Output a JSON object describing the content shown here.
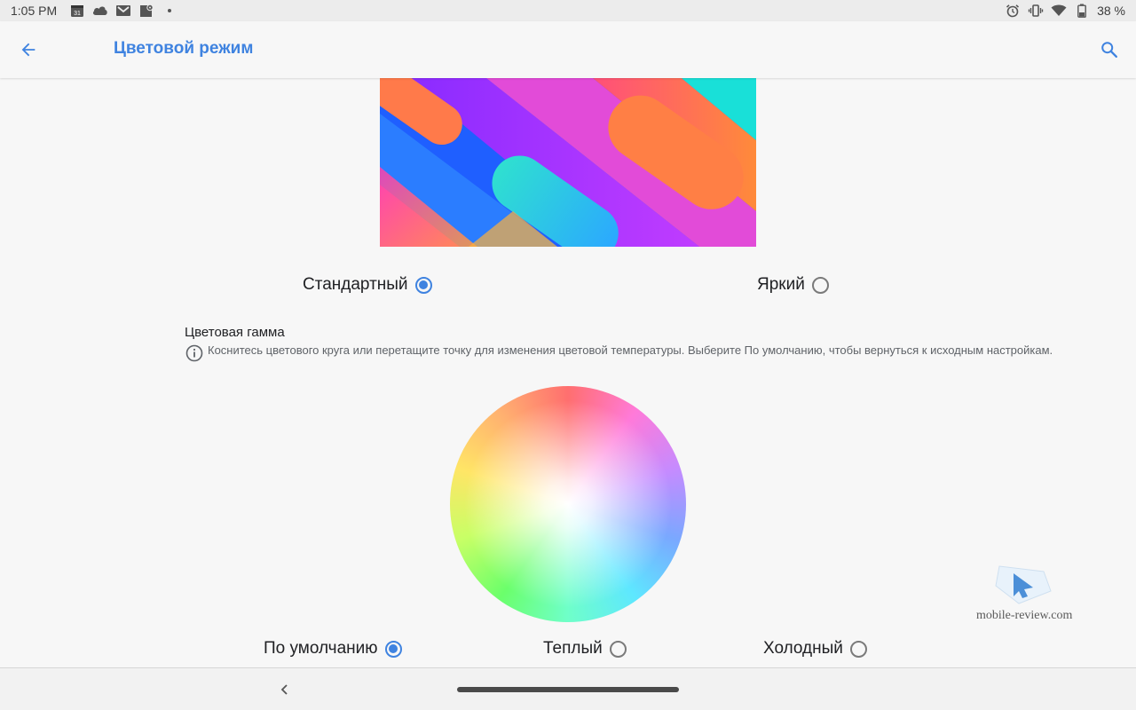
{
  "status_bar": {
    "time": "1:05 PM",
    "calendar_day": "31",
    "battery": "38 %",
    "left_icons": [
      "calendar-icon",
      "cloud-icon",
      "gmail-icon",
      "maps-icon",
      "dot-icon"
    ],
    "right_icons": [
      "alarm-icon",
      "vibrate-icon",
      "wifi-icon",
      "battery-icon"
    ]
  },
  "app_bar": {
    "title": "Цветовой режим",
    "back_icon": "arrow-back-icon",
    "search_icon": "search-icon",
    "accent_color": "#3f83e0"
  },
  "color_mode": {
    "options": [
      {
        "label": "Стандартный",
        "selected": true
      },
      {
        "label": "Яркий",
        "selected": false
      }
    ]
  },
  "color_gamut": {
    "title": "Цветовая гамма",
    "hint": "Коснитесь цветового круга или перетащите точку для изменения цветовой температуры. Выберите По умолчанию, чтобы вернуться к исходным настройкам.",
    "options": [
      {
        "label": "По умолчанию",
        "selected": true
      },
      {
        "label": "Теплый",
        "selected": false
      },
      {
        "label": "Холодный",
        "selected": false
      }
    ]
  },
  "watermark": {
    "text": "mobile-review.com"
  },
  "nav_bar": {
    "back_icon": "nav-back-icon",
    "home_icon": "home-pill-icon"
  }
}
